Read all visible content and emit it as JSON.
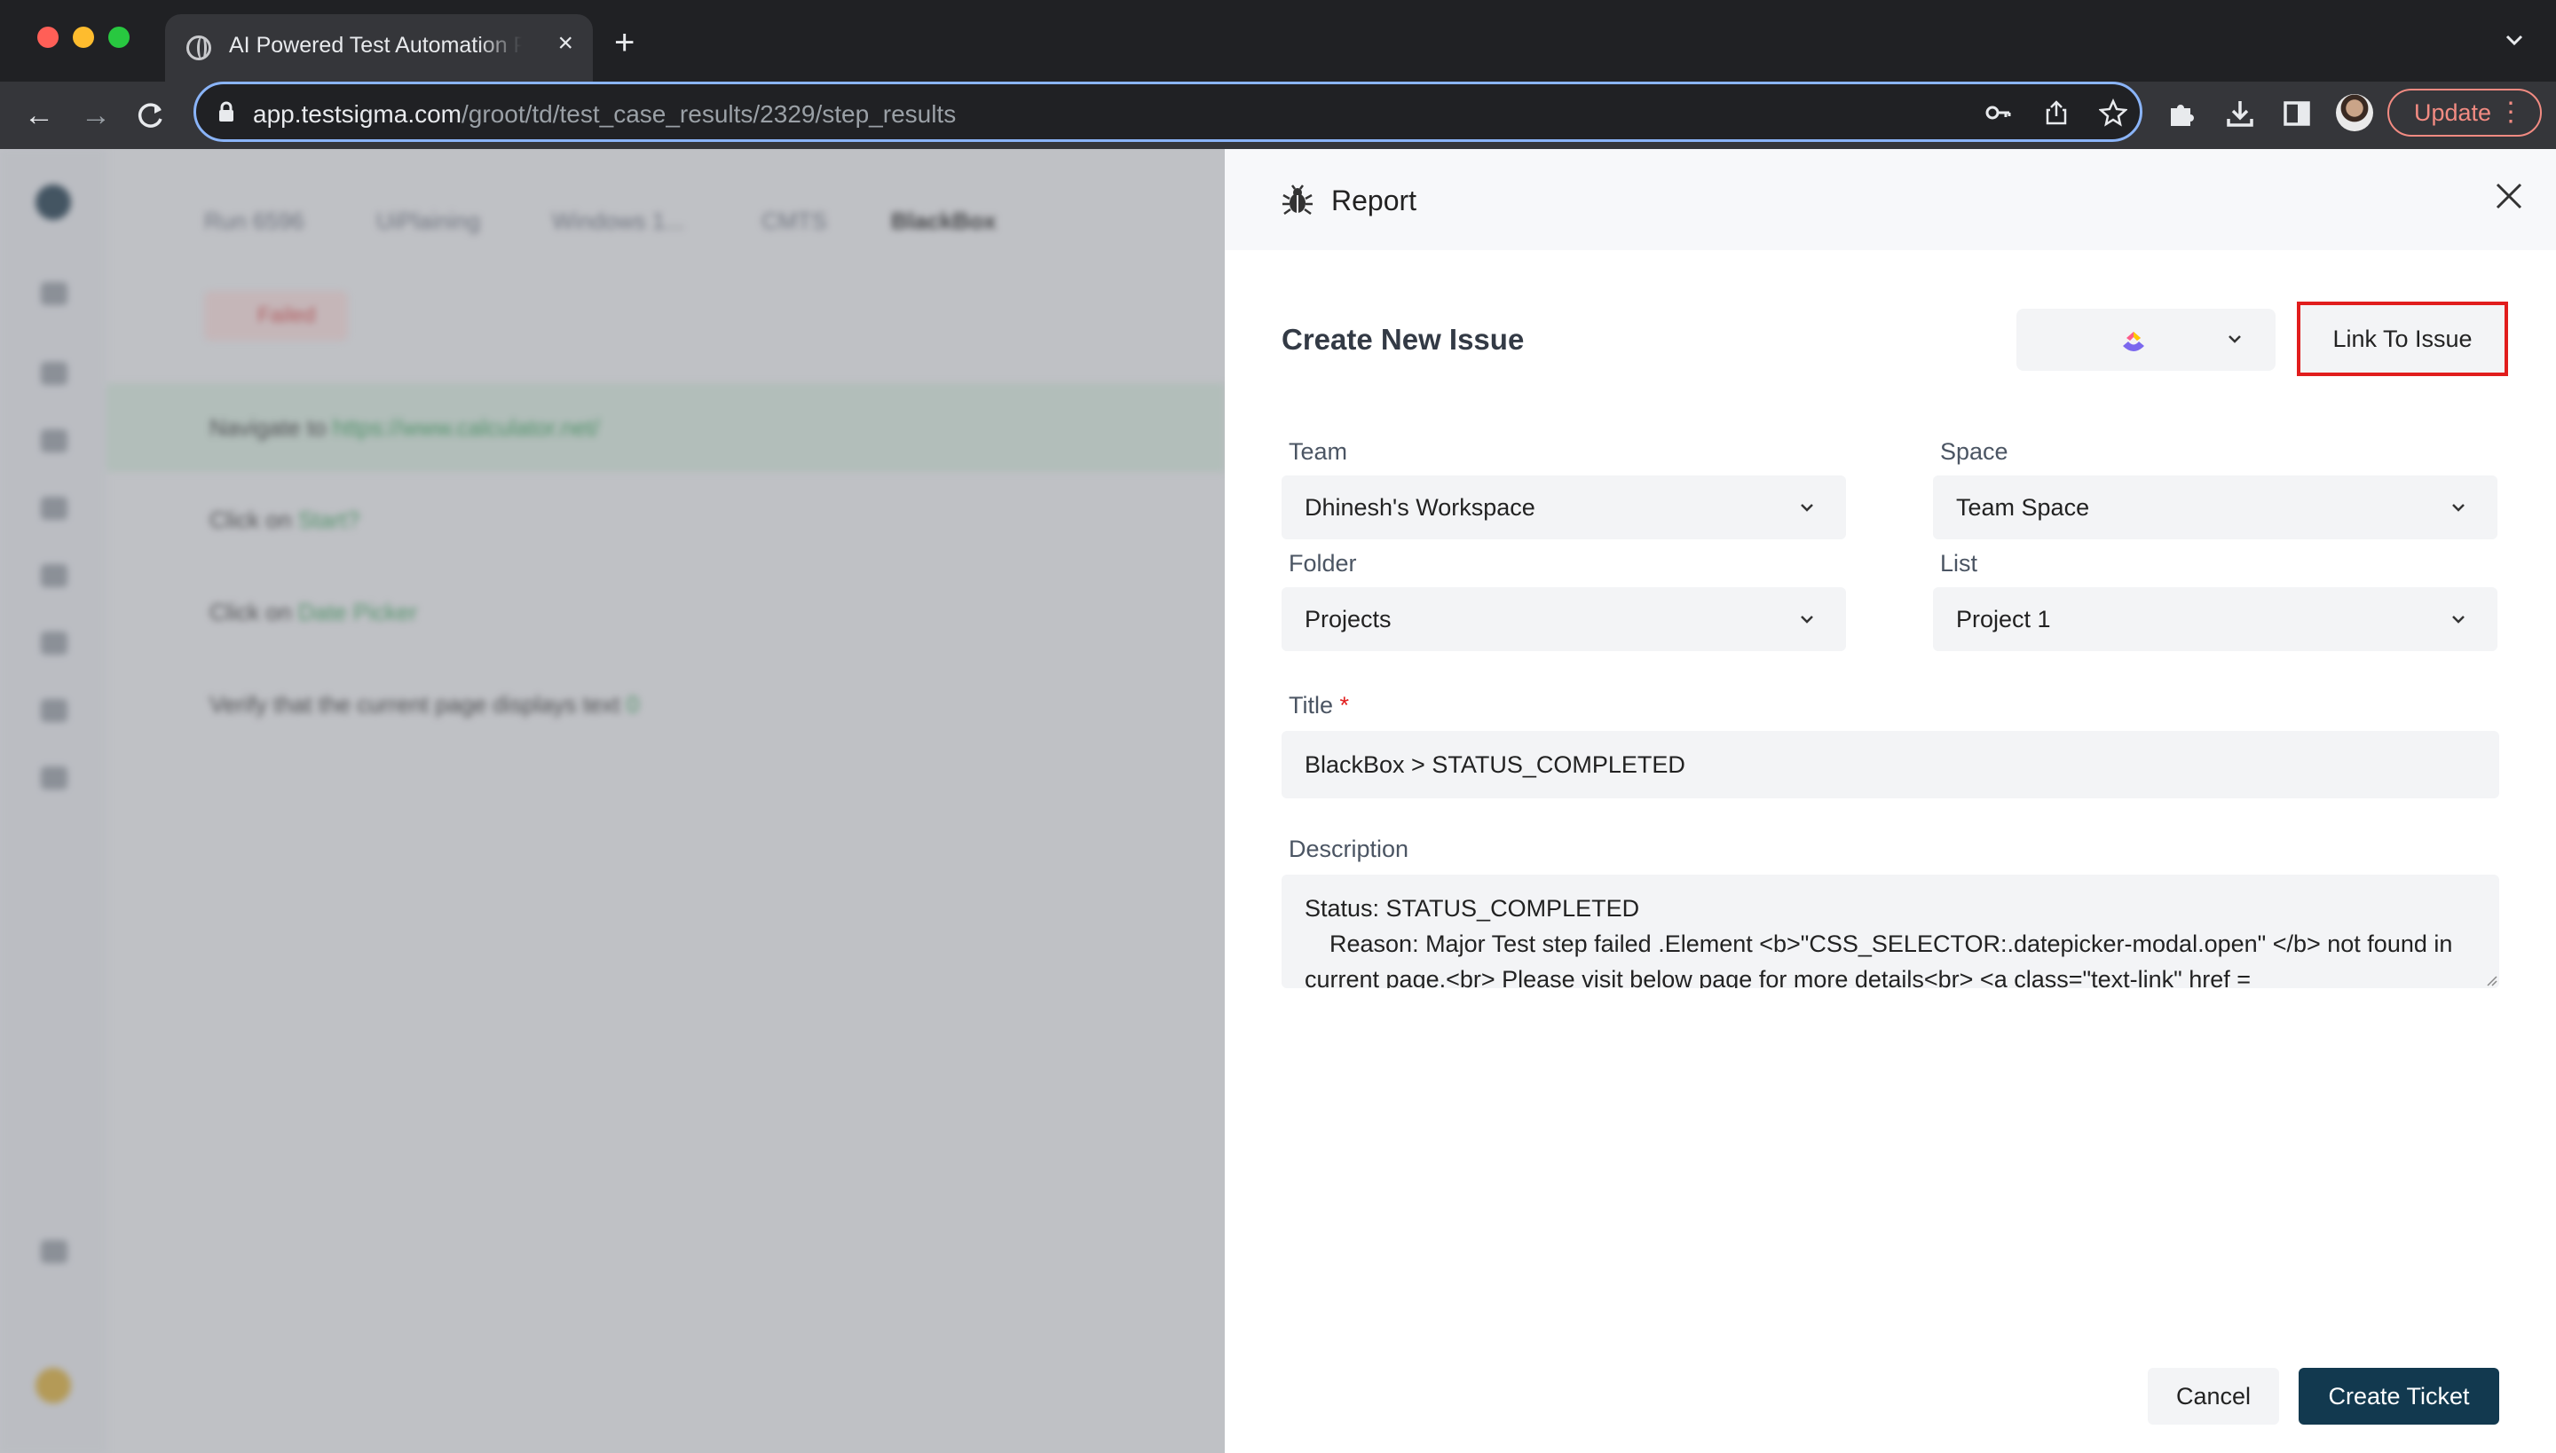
{
  "browser": {
    "tab_title": "AI Powered Test Automation Platform",
    "url_host": "app.testsigma.com",
    "url_path": "/groot/td/test_case_results/2329/step_results",
    "update_label": "Update"
  },
  "background_app": {
    "breadcrumbs": [
      "Run 6596",
      "UiPlaining",
      "Windows 1...",
      "CMTS",
      "BlackBox"
    ],
    "status_chip": "Failed",
    "steps": [
      {
        "text": "Navigate to",
        "value": "https://www.calculator.net/"
      },
      {
        "text": "Click on",
        "value": "Start?"
      },
      {
        "text": "Click on",
        "value": "Date Picker"
      },
      {
        "text": "Verify that the current page displays text",
        "value": "0"
      }
    ]
  },
  "panel": {
    "title": "Report",
    "section_title": "Create New Issue",
    "provider_icon": "clickup-logo",
    "link_button": "Link To Issue",
    "fields": {
      "team": {
        "label": "Team",
        "value": "Dhinesh's Workspace"
      },
      "space": {
        "label": "Space",
        "value": "Team Space"
      },
      "folder": {
        "label": "Folder",
        "value": "Projects"
      },
      "list": {
        "label": "List",
        "value": "Project 1"
      },
      "title": {
        "label": "Title",
        "required_mark": "*",
        "value": "BlackBox > STATUS_COMPLETED"
      },
      "description": {
        "label": "Description",
        "line1": "Status: STATUS_COMPLETED",
        "line2": "Reason: Major Test step failed .Element <b>\"CSS_SELECTOR:.datepicker-modal.open\" </b> not found in",
        "line3": "current page.<br> Please visit below page for more details<br> <a class=\"text-link\" href ="
      }
    },
    "cancel_button": "Cancel",
    "create_button": "Create Ticket"
  },
  "colors": {
    "highlight_border": "#e11d1d",
    "primary_button": "#12394f",
    "omnibox_focus": "#8ab4f8"
  }
}
